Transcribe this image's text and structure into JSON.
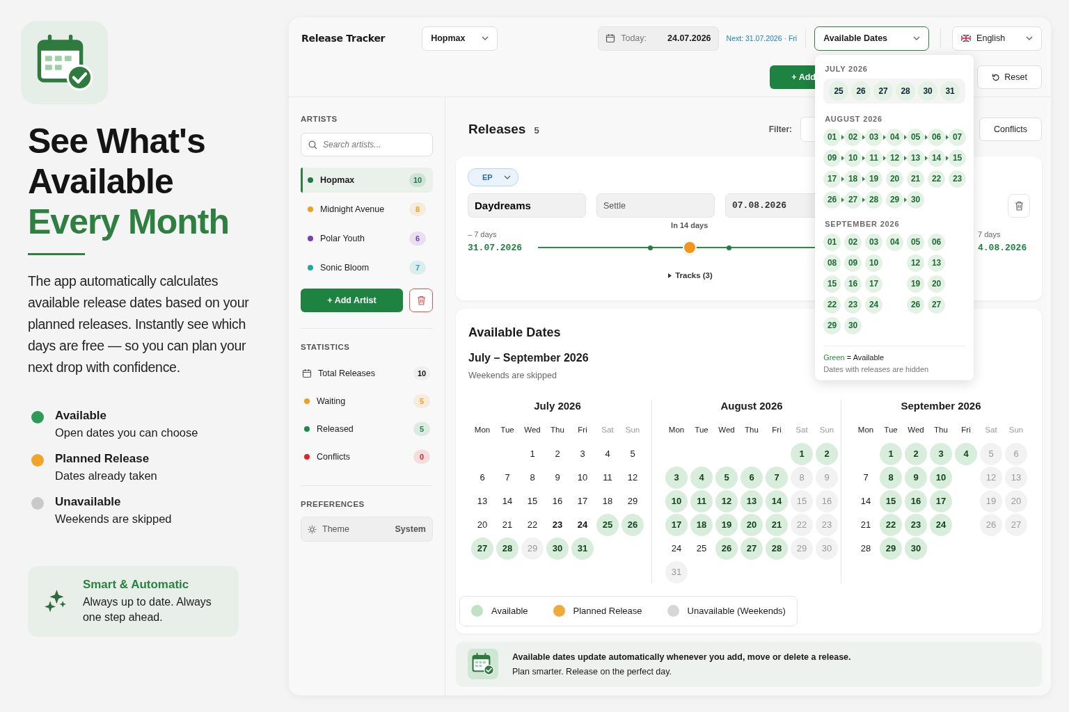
{
  "hero": {
    "title_lines": [
      {
        "text": "See What's",
        "accent": false
      },
      {
        "text": "Available",
        "accent": false
      },
      {
        "text": "Every Month",
        "accent": true
      }
    ],
    "description": "The app automatically calculates available release dates based on your planned releases. Instantly see which days are free — so you can plan your next drop with confidence.",
    "legend": [
      {
        "title": "Available",
        "subtitle": "Open dates you can choose",
        "color": "#2e9a57"
      },
      {
        "title": "Planned Release",
        "subtitle": "Dates already taken",
        "color": "#f0a52a"
      },
      {
        "title": "Unavailable",
        "subtitle": "Weekends are skipped",
        "color": "#c9c9c9"
      }
    ],
    "feature": {
      "title": "Smart & Automatic",
      "text": "Always up to date. Always one step ahead."
    }
  },
  "header": {
    "app_title": "Release Tracker",
    "artist_select": "Hopmax",
    "today_label": "Today:",
    "today_value": "24.07.2026",
    "next": "Next: 31.07.2026 · Fri",
    "view_select": "Available Dates",
    "language": "English",
    "add_button": "+ Add",
    "reset_button": "Reset"
  },
  "dropdown": {
    "months": [
      {
        "title": "JULY 2026",
        "highlighted": true,
        "rows": [
          [
            {
              "day": "25",
              "kind": "chip",
              "arrow": false
            },
            {
              "day": "26",
              "kind": "chip",
              "arrow": false
            },
            {
              "day": "27",
              "kind": "chip",
              "arrow": false
            },
            {
              "day": "28",
              "kind": "chip",
              "arrow": false
            },
            {
              "day": "30",
              "kind": "chip",
              "arrow": false
            },
            {
              "day": "31",
              "kind": "chip",
              "arrow": false
            }
          ]
        ]
      },
      {
        "title": "AUGUST 2026",
        "highlighted": false,
        "rows": [
          [
            {
              "day": "01",
              "kind": "chip",
              "arrow": true
            },
            {
              "day": "02",
              "kind": "chip",
              "arrow": true
            },
            {
              "day": "03",
              "kind": "chip",
              "arrow": true
            },
            {
              "day": "04",
              "kind": "chip",
              "arrow": true
            },
            {
              "day": "05",
              "kind": "chip",
              "arrow": true
            },
            {
              "day": "06",
              "kind": "chip",
              "arrow": true
            },
            {
              "day": "07",
              "kind": "chip",
              "arrow": false
            }
          ],
          [
            {
              "day": "09",
              "kind": "chip",
              "arrow": true
            },
            {
              "day": "10",
              "kind": "chip",
              "arrow": true
            },
            {
              "day": "11",
              "kind": "chip",
              "arrow": true
            },
            {
              "day": "12",
              "kind": "chip",
              "arrow": true
            },
            {
              "day": "13",
              "kind": "chip",
              "arrow": true
            },
            {
              "day": "14",
              "kind": "chip",
              "arrow": true
            },
            {
              "day": "15",
              "kind": "chip",
              "arrow": false
            }
          ],
          [
            {
              "day": "17",
              "kind": "chip",
              "arrow": true
            },
            {
              "day": "18",
              "kind": "chip",
              "arrow": true
            },
            {
              "day": "19",
              "kind": "chip",
              "arrow": false
            },
            {
              "day": "20",
              "kind": "chip",
              "arrow": false
            },
            {
              "day": "21",
              "kind": "chip",
              "arrow": false
            },
            {
              "day": "22",
              "kind": "chip",
              "arrow": false
            },
            {
              "day": "23",
              "kind": "chip",
              "arrow": false
            }
          ],
          [
            {
              "day": "26",
              "kind": "chip",
              "arrow": true
            },
            {
              "day": "27",
              "kind": "chip",
              "arrow": true
            },
            {
              "day": "28",
              "kind": "chip",
              "arrow": false
            },
            {
              "day": "29",
              "kind": "chip",
              "arrow": true
            },
            {
              "day": "30",
              "kind": "chip",
              "arrow": false
            }
          ]
        ]
      },
      {
        "title": "SEPTEMBER 2026",
        "highlighted": false,
        "rows": [
          [
            {
              "day": "01",
              "kind": "chip",
              "arrow": false
            },
            {
              "day": "02",
              "kind": "chip",
              "arrow": false
            },
            {
              "day": "03",
              "kind": "chip",
              "arrow": false
            },
            {
              "day": "04",
              "kind": "chip",
              "arrow": false
            },
            {
              "day": "05",
              "kind": "chip",
              "arrow": false
            },
            {
              "day": "06",
              "kind": "chip",
              "arrow": false
            }
          ],
          [
            {
              "day": "08",
              "kind": "chip",
              "arrow": false
            },
            {
              "day": "09",
              "kind": "chip",
              "arrow": false
            },
            {
              "day": "10",
              "kind": "chip",
              "arrow": false
            },
            {
              "kind": "empty"
            },
            {
              "day": "12",
              "kind": "chip",
              "arrow": false
            },
            {
              "day": "13",
              "kind": "chip",
              "arrow": false
            }
          ],
          [
            {
              "day": "15",
              "kind": "chip",
              "arrow": false
            },
            {
              "day": "16",
              "kind": "chip",
              "arrow": false
            },
            {
              "day": "17",
              "kind": "chip",
              "arrow": false
            },
            {
              "kind": "empty"
            },
            {
              "day": "19",
              "kind": "chip",
              "arrow": false
            },
            {
              "day": "20",
              "kind": "chip",
              "arrow": false
            }
          ],
          [
            {
              "day": "22",
              "kind": "chip",
              "arrow": false
            },
            {
              "day": "23",
              "kind": "chip",
              "arrow": false
            },
            {
              "day": "24",
              "kind": "chip",
              "arrow": false
            },
            {
              "kind": "empty"
            },
            {
              "day": "26",
              "kind": "chip",
              "arrow": false
            },
            {
              "day": "27",
              "kind": "chip",
              "arrow": false
            }
          ],
          [
            {
              "day": "29",
              "kind": "chip",
              "arrow": false
            },
            {
              "day": "30",
              "kind": "chip",
              "arrow": false
            }
          ]
        ]
      }
    ],
    "legend_key": "Green",
    "legend_value": "= Available",
    "note": "Dates with releases are hidden"
  },
  "sidebar": {
    "artists_heading": "ARTISTS",
    "search_placeholder": "Search artists...",
    "artists": [
      {
        "name": "Hopmax",
        "count": "10",
        "color": "#1f7a3f",
        "selected": true
      },
      {
        "name": "Midnight Avenue",
        "count": "8",
        "color": "#f0a020",
        "selected": false
      },
      {
        "name": "Polar Youth",
        "count": "6",
        "color": "#7b3db5",
        "selected": false
      },
      {
        "name": "Sonic Bloom",
        "count": "7",
        "color": "#1fa8a8",
        "selected": false
      }
    ],
    "add_artist": "+ Add Artist",
    "statistics_heading": "STATISTICS",
    "statistics": [
      {
        "label": "Total Releases",
        "value": "10",
        "kind": "icon"
      },
      {
        "label": "Waiting",
        "value": "5",
        "kind": "dot",
        "color": "#f0a020"
      },
      {
        "label": "Released",
        "value": "5",
        "kind": "dot",
        "color": "#1f8a48"
      },
      {
        "label": "Conflicts",
        "value": "0",
        "kind": "dot",
        "color": "#e02424"
      }
    ],
    "preferences_heading": "PREFERENCES",
    "theme_label": "Theme",
    "theme_value": "System"
  },
  "releases": {
    "title": "Releases",
    "count": "5",
    "filter_label": "Filter:",
    "conflicts_button": "Conflicts",
    "release": {
      "type": "EP",
      "title": "Daydreams",
      "artist": "Settle",
      "date": "07.08.2026",
      "before_label": "– 7 days",
      "before_date": "31.07.2026",
      "center_label": "In 14 days",
      "after_label": "7 days",
      "after_date": "4.08.2026",
      "level": 0.35,
      "tracks": "Tracks (3)"
    }
  },
  "available": {
    "title": "Available Dates",
    "range": "July – September 2026",
    "note": "Weekends are skipped",
    "months": [
      {
        "title": "July 2026",
        "weekdays": [
          {
            "label": "Mon",
            "weekend": false
          },
          {
            "label": "Tue",
            "weekend": false
          },
          {
            "label": "Wed",
            "weekend": false
          },
          {
            "label": "Thu",
            "weekend": false
          },
          {
            "label": "Fri",
            "weekend": false
          },
          {
            "label": "Sat",
            "weekend": true
          },
          {
            "label": "Sun",
            "weekend": true
          }
        ],
        "weeks": [
          [
            {
              "kind": "empty"
            },
            {
              "kind": "empty"
            },
            {
              "day": "1",
              "kind": "plain"
            },
            {
              "day": "2",
              "kind": "plain"
            },
            {
              "day": "3",
              "kind": "plain"
            },
            {
              "day": "4",
              "kind": "plain"
            },
            {
              "day": "5",
              "kind": "plain"
            }
          ],
          [
            {
              "day": "6",
              "kind": "plain"
            },
            {
              "day": "7",
              "kind": "plain"
            },
            {
              "day": "8",
              "kind": "plain"
            },
            {
              "day": "9",
              "kind": "plain"
            },
            {
              "day": "10",
              "kind": "plain"
            },
            {
              "day": "11",
              "kind": "plain"
            },
            {
              "day": "12",
              "kind": "plain"
            }
          ],
          [
            {
              "day": "13",
              "kind": "plain"
            },
            {
              "day": "14",
              "kind": "plain"
            },
            {
              "day": "15",
              "kind": "plain"
            },
            {
              "day": "16",
              "kind": "plain"
            },
            {
              "day": "17",
              "kind": "plain"
            },
            {
              "day": "18",
              "kind": "plain"
            },
            {
              "day": "29",
              "kind": "plain"
            }
          ],
          [
            {
              "day": "20",
              "kind": "plain"
            },
            {
              "day": "21",
              "kind": "plain"
            },
            {
              "day": "22",
              "kind": "plain"
            },
            {
              "day": "23",
              "kind": "emphasis"
            },
            {
              "day": "24",
              "kind": "emphasis"
            },
            {
              "day": "25",
              "kind": "available"
            },
            {
              "day": "26",
              "kind": "available"
            }
          ],
          [
            {
              "day": "27",
              "kind": "available"
            },
            {
              "day": "28",
              "kind": "available"
            },
            {
              "day": "29",
              "kind": "unavailable"
            },
            {
              "day": "30",
              "kind": "available"
            },
            {
              "day": "31",
              "kind": "available"
            }
          ]
        ]
      },
      {
        "title": "August 2026",
        "weekdays": [
          {
            "label": "Mon",
            "weekend": false
          },
          {
            "label": "Tue",
            "weekend": false
          },
          {
            "label": "Wed",
            "weekend": false
          },
          {
            "label": "Thu",
            "weekend": false
          },
          {
            "label": "Fri",
            "weekend": false
          },
          {
            "label": "Sat",
            "weekend": true
          },
          {
            "label": "Sun",
            "weekend": true
          }
        ],
        "weeks": [
          [
            {
              "kind": "empty"
            },
            {
              "kind": "empty"
            },
            {
              "kind": "empty"
            },
            {
              "kind": "empty"
            },
            {
              "kind": "empty"
            },
            {
              "day": "1",
              "kind": "available"
            },
            {
              "day": "2",
              "kind": "available"
            }
          ],
          [
            {
              "day": "3",
              "kind": "available"
            },
            {
              "day": "4",
              "kind": "available"
            },
            {
              "day": "5",
              "kind": "available"
            },
            {
              "day": "6",
              "kind": "available"
            },
            {
              "day": "7",
              "kind": "available"
            },
            {
              "day": "8",
              "kind": "unavailable"
            },
            {
              "day": "9",
              "kind": "unavailable"
            }
          ],
          [
            {
              "day": "10",
              "kind": "available"
            },
            {
              "day": "11",
              "kind": "available"
            },
            {
              "day": "12",
              "kind": "available"
            },
            {
              "day": "13",
              "kind": "available"
            },
            {
              "day": "14",
              "kind": "available"
            },
            {
              "day": "15",
              "kind": "unavailable"
            },
            {
              "day": "16",
              "kind": "unavailable"
            }
          ],
          [
            {
              "day": "17",
              "kind": "available"
            },
            {
              "day": "18",
              "kind": "available"
            },
            {
              "day": "19",
              "kind": "available"
            },
            {
              "day": "20",
              "kind": "available"
            },
            {
              "day": "21",
              "kind": "available"
            },
            {
              "day": "22",
              "kind": "unavailable"
            },
            {
              "day": "23",
              "kind": "unavailable"
            }
          ],
          [
            {
              "day": "24",
              "kind": "plain"
            },
            {
              "day": "25",
              "kind": "plain"
            },
            {
              "day": "26",
              "kind": "available"
            },
            {
              "day": "27",
              "kind": "available"
            },
            {
              "day": "28",
              "kind": "available"
            },
            {
              "day": "29",
              "kind": "unavailable"
            },
            {
              "day": "30",
              "kind": "unavailable"
            }
          ],
          [
            {
              "day": "31",
              "kind": "unavailable"
            }
          ]
        ]
      },
      {
        "title": "September 2026",
        "weekdays": [
          {
            "label": "Mon",
            "weekend": false
          },
          {
            "label": "Tue",
            "weekend": false
          },
          {
            "label": "Wed",
            "weekend": false
          },
          {
            "label": "Thu",
            "weekend": false
          },
          {
            "label": "Fri",
            "weekend": false
          },
          {
            "label": "Sat",
            "weekend": true
          },
          {
            "label": "Sun",
            "weekend": true
          }
        ],
        "weeks": [
          [
            {
              "kind": "empty"
            },
            {
              "day": "1",
              "kind": "available"
            },
            {
              "day": "2",
              "kind": "available"
            },
            {
              "day": "3",
              "kind": "available"
            },
            {
              "day": "4",
              "kind": "available"
            },
            {
              "day": "5",
              "kind": "unavailable"
            },
            {
              "day": "6",
              "kind": "unavailable"
            }
          ],
          [
            {
              "day": "7",
              "kind": "plain"
            },
            {
              "day": "8",
              "kind": "available"
            },
            {
              "day": "9",
              "kind": "available"
            },
            {
              "day": "10",
              "kind": "available"
            },
            {
              "kind": "empty"
            },
            {
              "day": "12",
              "kind": "unavailable"
            },
            {
              "day": "13",
              "kind": "unavailable"
            }
          ],
          [
            {
              "day": "14",
              "kind": "plain"
            },
            {
              "day": "15",
              "kind": "available"
            },
            {
              "day": "16",
              "kind": "available"
            },
            {
              "day": "17",
              "kind": "available"
            },
            {
              "kind": "empty"
            },
            {
              "day": "19",
              "kind": "unavailable"
            },
            {
              "day": "20",
              "kind": "unavailable"
            }
          ],
          [
            {
              "day": "21",
              "kind": "plain"
            },
            {
              "day": "22",
              "kind": "available"
            },
            {
              "day": "23",
              "kind": "available"
            },
            {
              "day": "24",
              "kind": "available"
            },
            {
              "kind": "empty"
            },
            {
              "day": "26",
              "kind": "unavailable"
            },
            {
              "day": "27",
              "kind": "unavailable"
            }
          ],
          [
            {
              "day": "28",
              "kind": "plain"
            },
            {
              "day": "29",
              "kind": "available"
            },
            {
              "day": "30",
              "kind": "available"
            }
          ]
        ]
      }
    ],
    "legend": [
      {
        "label": "Available",
        "color": "#bfe2c5"
      },
      {
        "label": "Planned Release",
        "color": "#f2a93b"
      },
      {
        "label": "Unavailable (Weekends)",
        "color": "#d6d6d6"
      }
    ]
  },
  "banner": {
    "title": "Available dates update automatically whenever you add, move or delete a release.",
    "text": "Plan smarter. Release on the perfect day."
  }
}
